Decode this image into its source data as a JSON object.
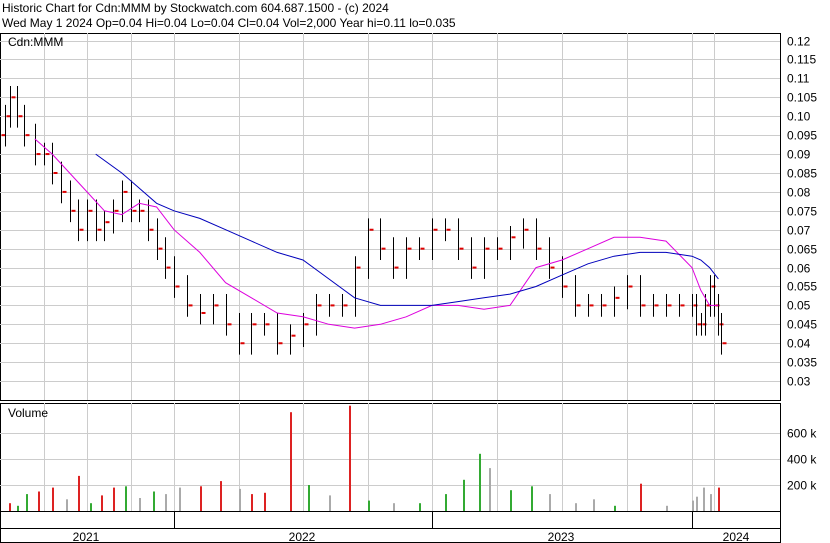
{
  "header": {
    "title": "Historic Chart for Cdn:MMM by Stockwatch.com 604.687.1500 - (c) 2024",
    "quote": "Wed May  1 2024   Op=0.04  Hi=0.04  Lo=0.04  Cl=0.04  Vol=2,000  Year hi=0.11  lo=0.035"
  },
  "colors": {
    "up": "#dd0000",
    "down": "#000000",
    "ma_short": "#dd00dd",
    "ma_long": "#0000bb",
    "vol_up": "#33aa33",
    "vol_down": "#dd2222",
    "vol_flat": "#aaaaaa",
    "grid": "#cccccc"
  },
  "chart_data": [
    {
      "type": "line",
      "title": "Cdn:MMM",
      "ylim": [
        0.025,
        0.122
      ],
      "yticks": [
        "0.12",
        "0.115",
        "0.11",
        "0.105",
        "0.10",
        "0.095",
        "0.09",
        "0.085",
        "0.08",
        "0.075",
        "0.07",
        "0.065",
        "0.06",
        "0.055",
        "0.05",
        "0.045",
        "0.04",
        "0.035",
        "0.03"
      ],
      "x_labels": [
        "2021",
        "2022",
        "2023",
        "2024"
      ],
      "series": [
        {
          "x": [
            0.0,
            0.03,
            0.06,
            0.1,
            0.14,
            0.2,
            0.25,
            0.3,
            0.35,
            0.4,
            0.45,
            0.5,
            0.55,
            0.6,
            0.65,
            0.7,
            0.75,
            0.8,
            0.85,
            0.9,
            0.95,
            1.0,
            1.05,
            1.1,
            1.15,
            1.2,
            1.25,
            1.3,
            1.35,
            1.4,
            1.45,
            1.5,
            1.55,
            1.6,
            1.65,
            1.7,
            1.75,
            1.8,
            1.85,
            1.9,
            1.95,
            2.0,
            2.05,
            2.1,
            2.15,
            2.2,
            2.25,
            2.3,
            2.35,
            2.4,
            2.45,
            2.5,
            2.55,
            2.6,
            2.65,
            2.7,
            2.75,
            2.8,
            2.85,
            2.9,
            2.95,
            3.0,
            3.05,
            3.1,
            3.15,
            3.2,
            3.25,
            3.3,
            3.33
          ],
          "values": [
            0.095,
            0.1,
            0.105,
            0.1,
            0.095,
            0.09,
            0.09,
            0.085,
            0.08,
            0.075,
            0.07,
            0.075,
            0.07,
            0.072,
            0.075,
            0.08,
            0.075,
            0.075,
            0.07,
            0.065,
            0.06,
            0.055,
            0.05,
            0.048,
            0.05,
            0.045,
            0.04,
            0.045,
            0.045,
            0.04,
            0.042,
            0.045,
            0.05,
            0.05,
            0.05,
            0.06,
            0.07,
            0.065,
            0.06,
            0.065,
            0.065,
            0.07,
            0.07,
            0.065,
            0.06,
            0.065,
            0.065,
            0.068,
            0.07,
            0.065,
            0.06,
            0.055,
            0.05,
            0.05,
            0.05,
            0.052,
            0.055,
            0.05,
            0.05,
            0.05,
            0.05,
            0.05,
            0.045,
            0.045,
            0.05,
            0.055,
            0.05,
            0.045,
            0.04
          ]
        },
        {
          "x": [
            0.2,
            0.3,
            0.4,
            0.5,
            0.6,
            0.7,
            0.8,
            0.9,
            1.0,
            1.1,
            1.2,
            1.3,
            1.4,
            1.5,
            1.6,
            1.7,
            1.8,
            1.9,
            2.0,
            2.1,
            2.2,
            2.3,
            2.4,
            2.5,
            2.6,
            2.7,
            2.8,
            2.9,
            3.0,
            3.1,
            3.2,
            3.3
          ],
          "values": [
            0.094,
            0.09,
            0.085,
            0.08,
            0.075,
            0.074,
            0.077,
            0.076,
            0.07,
            0.064,
            0.056,
            0.052,
            0.048,
            0.047,
            0.045,
            0.044,
            0.045,
            0.047,
            0.05,
            0.05,
            0.049,
            0.05,
            0.06,
            0.062,
            0.065,
            0.068,
            0.068,
            0.067,
            0.06,
            0.054,
            0.05,
            0.05
          ]
        },
        {
          "x": [
            0.55,
            0.7,
            0.8,
            0.9,
            1.0,
            1.1,
            1.2,
            1.3,
            1.4,
            1.5,
            1.6,
            1.7,
            1.8,
            1.9,
            2.0,
            2.1,
            2.2,
            2.3,
            2.4,
            2.5,
            2.6,
            2.7,
            2.8,
            2.9,
            3.0,
            3.1,
            3.2,
            3.3
          ],
          "values": [
            0.09,
            0.085,
            0.081,
            0.077,
            0.075,
            0.073,
            0.07,
            0.067,
            0.064,
            0.062,
            0.057,
            0.052,
            0.05,
            0.05,
            0.05,
            0.051,
            0.052,
            0.053,
            0.055,
            0.058,
            0.061,
            0.063,
            0.064,
            0.064,
            0.063,
            0.062,
            0.06,
            0.057
          ]
        }
      ]
    },
    {
      "type": "bar",
      "title": "Volume",
      "ylim": [
        0,
        800000
      ],
      "yticks": [
        "600 k",
        "400 k",
        "200 k"
      ],
      "bars": [
        {
          "x": 0.05,
          "v": 60000,
          "c": "vol_down"
        },
        {
          "x": 0.1,
          "v": 40000,
          "c": "vol_up"
        },
        {
          "x": 0.15,
          "v": 130000,
          "c": "vol_up"
        },
        {
          "x": 0.22,
          "v": 150000,
          "c": "vol_down"
        },
        {
          "x": 0.3,
          "v": 180000,
          "c": "vol_down"
        },
        {
          "x": 0.38,
          "v": 90000,
          "c": "vol_flat"
        },
        {
          "x": 0.45,
          "v": 270000,
          "c": "vol_down"
        },
        {
          "x": 0.52,
          "v": 60000,
          "c": "vol_up"
        },
        {
          "x": 0.58,
          "v": 120000,
          "c": "vol_down"
        },
        {
          "x": 0.65,
          "v": 180000,
          "c": "vol_down"
        },
        {
          "x": 0.72,
          "v": 190000,
          "c": "vol_up"
        },
        {
          "x": 0.8,
          "v": 100000,
          "c": "vol_flat"
        },
        {
          "x": 0.88,
          "v": 150000,
          "c": "vol_up"
        },
        {
          "x": 0.95,
          "v": 130000,
          "c": "vol_flat"
        },
        {
          "x": 1.02,
          "v": 180000,
          "c": "vol_flat"
        },
        {
          "x": 1.1,
          "v": 190000,
          "c": "vol_down"
        },
        {
          "x": 1.18,
          "v": 230000,
          "c": "vol_down"
        },
        {
          "x": 1.25,
          "v": 170000,
          "c": "vol_flat"
        },
        {
          "x": 1.3,
          "v": 130000,
          "c": "vol_down"
        },
        {
          "x": 1.35,
          "v": 140000,
          "c": "vol_down"
        },
        {
          "x": 1.45,
          "v": 760000,
          "c": "vol_down"
        },
        {
          "x": 1.52,
          "v": 200000,
          "c": "vol_up"
        },
        {
          "x": 1.6,
          "v": 120000,
          "c": "vol_flat"
        },
        {
          "x": 1.68,
          "v": 810000,
          "c": "vol_down"
        },
        {
          "x": 1.75,
          "v": 80000,
          "c": "vol_up"
        },
        {
          "x": 1.85,
          "v": 60000,
          "c": "vol_flat"
        },
        {
          "x": 1.95,
          "v": 60000,
          "c": "vol_up"
        },
        {
          "x": 2.05,
          "v": 130000,
          "c": "vol_up"
        },
        {
          "x": 2.12,
          "v": 240000,
          "c": "vol_up"
        },
        {
          "x": 2.18,
          "v": 440000,
          "c": "vol_up"
        },
        {
          "x": 2.22,
          "v": 330000,
          "c": "vol_flat"
        },
        {
          "x": 2.3,
          "v": 160000,
          "c": "vol_up"
        },
        {
          "x": 2.38,
          "v": 190000,
          "c": "vol_up"
        },
        {
          "x": 2.45,
          "v": 130000,
          "c": "vol_flat"
        },
        {
          "x": 2.55,
          "v": 60000,
          "c": "vol_flat"
        },
        {
          "x": 2.62,
          "v": 90000,
          "c": "vol_flat"
        },
        {
          "x": 2.7,
          "v": 40000,
          "c": "vol_up"
        },
        {
          "x": 2.8,
          "v": 210000,
          "c": "vol_down"
        },
        {
          "x": 2.9,
          "v": 40000,
          "c": "vol_flat"
        },
        {
          "x": 3.0,
          "v": 80000,
          "c": "vol_flat"
        },
        {
          "x": 3.05,
          "v": 110000,
          "c": "vol_flat"
        },
        {
          "x": 3.12,
          "v": 180000,
          "c": "vol_flat"
        },
        {
          "x": 3.2,
          "v": 130000,
          "c": "vol_flat"
        },
        {
          "x": 3.3,
          "v": 180000,
          "c": "vol_down"
        }
      ]
    }
  ]
}
